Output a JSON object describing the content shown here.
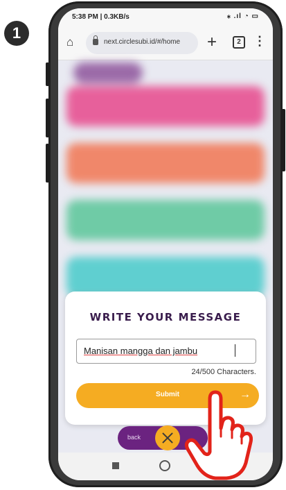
{
  "step": {
    "number": "1"
  },
  "statusbar": {
    "left": "5:38 PM | 0.3KB/s",
    "right": "⁎ .ıl ◔ ▭"
  },
  "browser": {
    "url": "next.circlesubi.id/#/home",
    "tab_count": "2",
    "menu": "⋮",
    "home": "⌂",
    "new_tab": "+"
  },
  "background_cards": [
    {
      "color": "#e7609b"
    },
    {
      "color": "#f0876a"
    },
    {
      "color": "#6fcba6"
    },
    {
      "color": "#5fcfd0"
    }
  ],
  "modal": {
    "title": "WRITE YOUR MESSAGE",
    "input_value": "Manisan mangga dan jambu",
    "char_count": "24/500 Characters.",
    "submit_label": "Submit",
    "submit_arrow": "→"
  },
  "bottom": {
    "back_label": "back"
  },
  "colors": {
    "accent": "#f5ac22",
    "title": "#3a1d4d",
    "pill": "#6b2380"
  }
}
